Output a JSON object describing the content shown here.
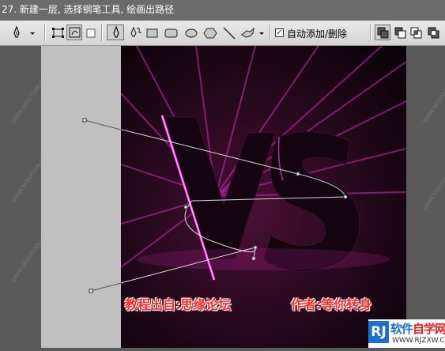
{
  "caption": "27. 新建一层, 选择钢笔工具, 绘画出路径",
  "options_bar": {
    "auto_add_delete_label": "自动添加/删除",
    "auto_add_delete_checked": true,
    "active_tool": "pen-tool",
    "active_mode": "paths-mode",
    "tools": [
      "pen-tool-icon",
      "shape-layers-mode-icon",
      "paths-mode-icon",
      "fill-pixels-mode-icon",
      "pen-icon",
      "freeform-pen-icon",
      "rectangle-icon",
      "rounded-rectangle-icon",
      "ellipse-icon",
      "polygon-icon",
      "line-icon",
      "custom-shape-icon",
      "add-to-path-icon",
      "subtract-from-path-icon",
      "intersect-path-icon",
      "exclude-path-icon"
    ]
  },
  "artwork": {
    "big_text": "VS",
    "credit_left": "教程出自:思缘论坛",
    "credit_right": "作者:等你转身"
  },
  "watermark": {
    "side_text": "WWW.MISSYUAN.COM"
  },
  "logo": {
    "mark": "RJ",
    "name_part1": "软件",
    "name_part2": "自学网",
    "url": "WWW.RJZXW.COM"
  },
  "colors": {
    "accent": "#ff2a2a",
    "artwork_bg": "#1e0716",
    "neon": "#ff3cf0"
  }
}
